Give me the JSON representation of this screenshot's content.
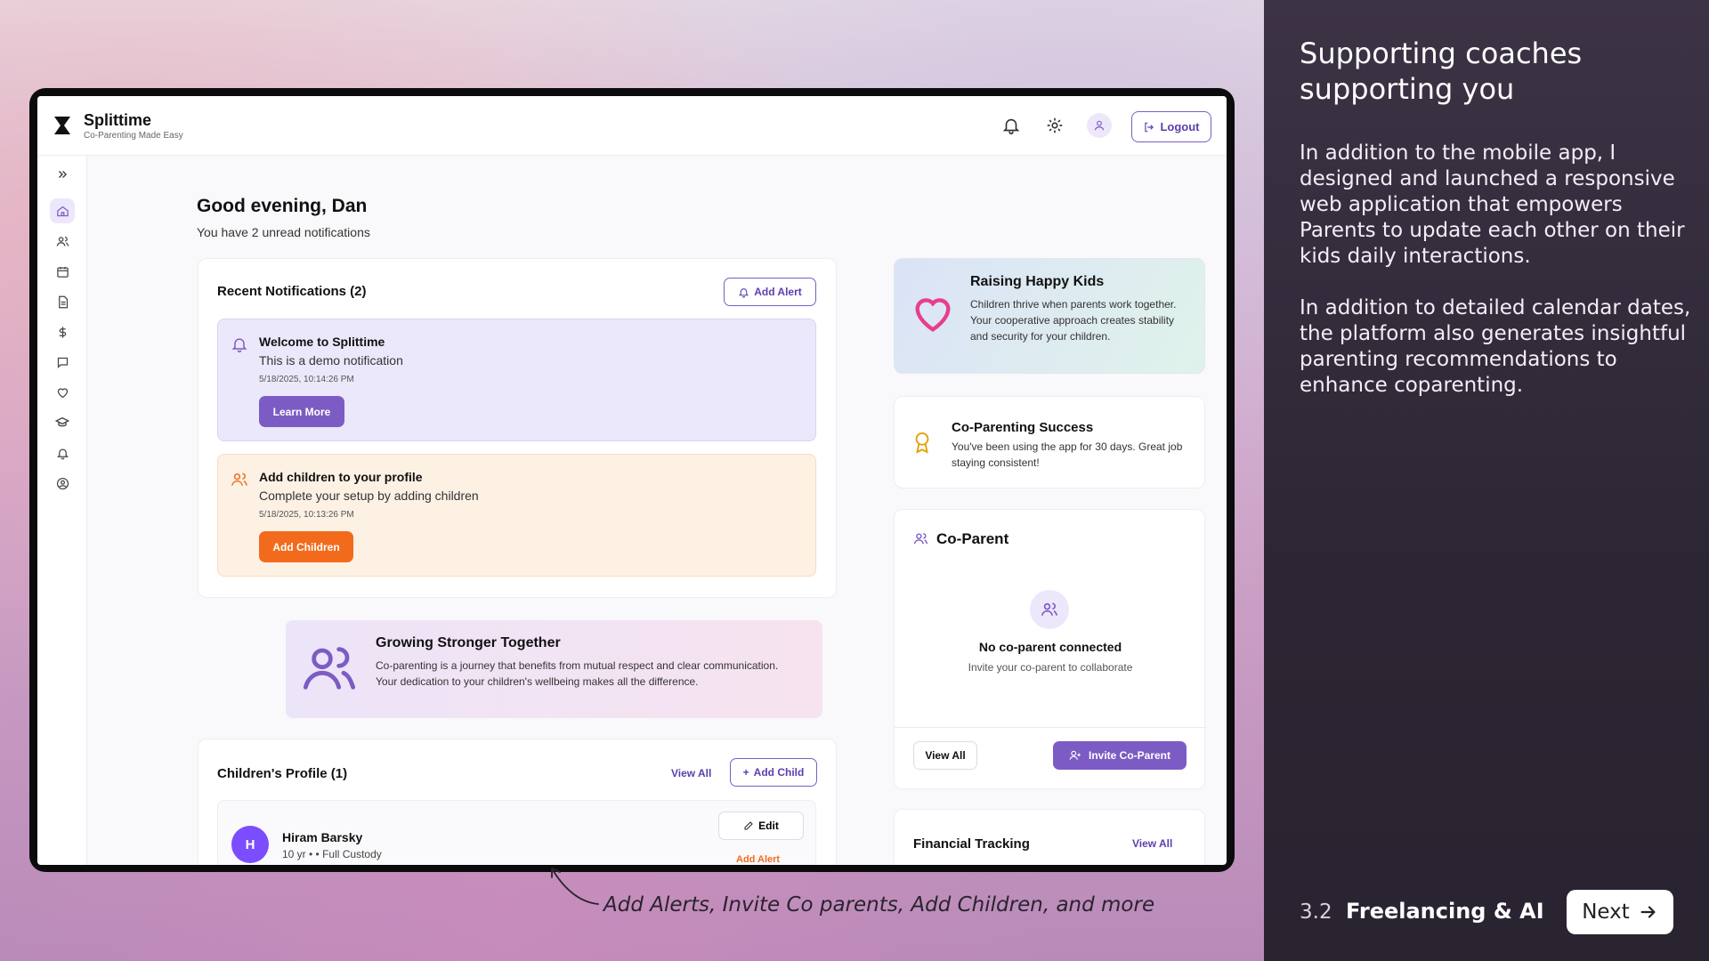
{
  "slide": {
    "heading": "Supporting coaches supporting you",
    "paragraph_1": "In addition to the mobile app, I designed and launched a responsive web application that empowers Parents to update each other on their kids daily interactions.",
    "paragraph_2": "In addition to detailed calendar dates, the platform also generates insightful parenting recommendations to enhance coparenting.",
    "section_number": "3.2",
    "section_title": "Freelancing & AI",
    "next_label": "Next",
    "caption": "Add Alerts, Invite Co parents, Add Children, and more"
  },
  "app": {
    "brand": "Splittime",
    "tagline": "Co-Parenting Made Easy",
    "logout_label": "Logout",
    "greeting": "Good evening, Dan",
    "greeting_sub": "You have 2 unread notifications",
    "sidebar_icons": [
      "expand-icon",
      "home-icon",
      "users-icon",
      "calendar-icon",
      "document-icon",
      "dollar-icon",
      "message-icon",
      "heart-icon",
      "graduation-icon",
      "bell-icon",
      "user-circle-icon"
    ],
    "notifications": {
      "title": "Recent Notifications (2)",
      "add_alert_label": "Add Alert",
      "items": [
        {
          "title": "Welcome to Splittime",
          "message": "This is a demo notification",
          "time": "5/18/2025, 10:14:26 PM",
          "button": "Learn More"
        },
        {
          "title": "Add children to your profile",
          "message": "Complete your setup by adding children",
          "time": "5/18/2025, 10:13:26 PM",
          "button": "Add Children"
        }
      ]
    },
    "growing": {
      "title": "Growing Stronger Together",
      "text": "Co-parenting is a journey that benefits from mutual respect and clear communication. Your dedication to your children's wellbeing makes all the difference."
    },
    "children": {
      "title": "Children's Profile (1)",
      "view_all": "View All",
      "add_child": "Add Child",
      "child_initial": "H",
      "child_name": "Hiram Barsky",
      "child_meta": "10 yr • • Full Custody",
      "edit": "Edit",
      "add_alert": "Add Alert"
    },
    "raising": {
      "title": "Raising Happy Kids",
      "text": "Children thrive when parents work together. Your cooperative approach creates stability and security for your children."
    },
    "success": {
      "title": "Co-Parenting Success",
      "text": "You've been using the app for 30 days. Great job staying consistent!"
    },
    "coparent": {
      "title": "Co-Parent",
      "empty_title": "No co-parent connected",
      "empty_sub": "Invite your co-parent to collaborate",
      "view_all": "View All",
      "invite": "Invite Co-Parent"
    },
    "financial": {
      "title": "Financial Tracking",
      "view_all": "View All"
    }
  },
  "colors": {
    "accent": "#7c5cc4",
    "orange": "#f26b1d",
    "panel": "#2f2937"
  }
}
